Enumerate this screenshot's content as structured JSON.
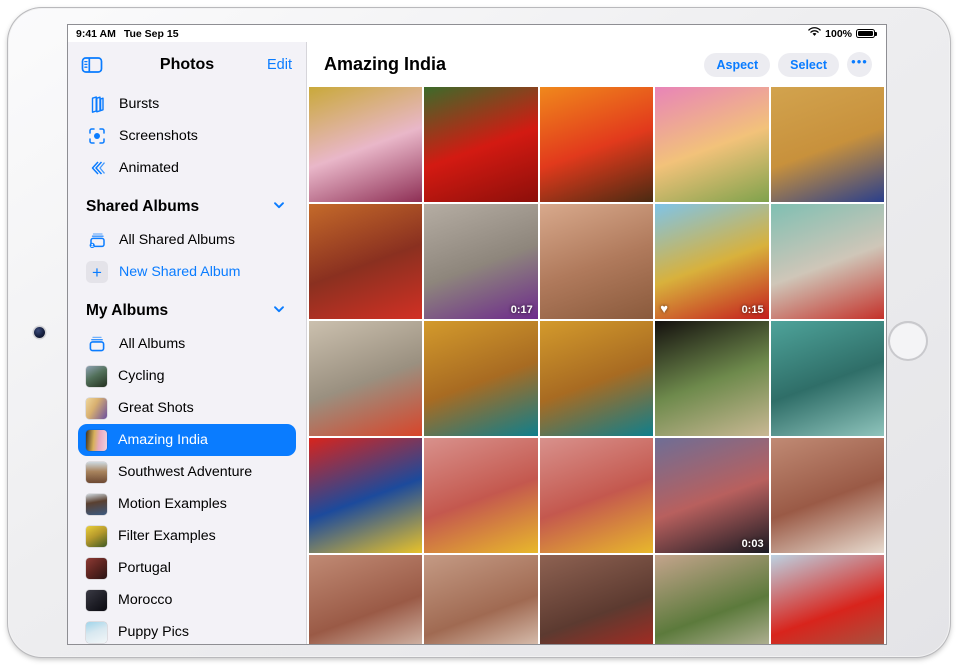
{
  "status_bar": {
    "time": "9:41 AM",
    "date": "Tue Sep 15",
    "wifi_icon": "wifi-icon",
    "battery_percent": "100%",
    "battery_icon": "battery-icon"
  },
  "sidebar": {
    "toggle_icon": "sidebar-toggle-icon",
    "title": "Photos",
    "edit_label": "Edit",
    "items": [
      {
        "label": "Bursts",
        "icon": "bursts-icon",
        "kind": "glyph",
        "selected": false
      },
      {
        "label": "Screenshots",
        "icon": "screenshots-icon",
        "kind": "glyph",
        "selected": false
      },
      {
        "label": "Animated",
        "icon": "animated-icon",
        "kind": "glyph",
        "selected": false
      }
    ],
    "shared_albums": {
      "heading": "Shared Albums",
      "chevron_icon": "chevron-down-icon",
      "items": [
        {
          "label": "All Shared Albums",
          "icon": "shared-album-icon",
          "kind": "glyph",
          "selected": false
        },
        {
          "label": "New Shared Album",
          "icon": "plus-icon",
          "kind": "plus",
          "selected": false,
          "accent": true
        }
      ]
    },
    "my_albums": {
      "heading": "My Albums",
      "chevron_icon": "chevron-down-icon",
      "items": [
        {
          "label": "All Albums",
          "icon": "albums-stack-icon",
          "kind": "glyph",
          "selected": false
        },
        {
          "label": "Cycling",
          "icon": "album-thumbnail",
          "kind": "thumb",
          "selected": false,
          "c1": "#7b8a9a",
          "c2": "#2d3a2a"
        },
        {
          "label": "Great Shots",
          "icon": "album-thumbnail",
          "kind": "thumb",
          "selected": false,
          "c1": "#e8c98a",
          "c2": "#6b4fa0"
        },
        {
          "label": "Amazing India",
          "icon": "album-thumbnail",
          "kind": "thumb",
          "selected": true,
          "c1": "#d8b15a",
          "c2": "#e7a9c0"
        },
        {
          "label": "Southwest Adventure",
          "icon": "album-thumbnail",
          "kind": "thumb",
          "selected": false,
          "c1": "#9c7a5c",
          "c2": "#d8cfc2"
        },
        {
          "label": "Motion Examples",
          "icon": "album-thumbnail",
          "kind": "thumb",
          "selected": false,
          "c1": "#b9c3cc",
          "c2": "#3c5a80"
        },
        {
          "label": "Filter Examples",
          "icon": "album-thumbnail",
          "kind": "thumb",
          "selected": false,
          "c1": "#e3c32e",
          "c2": "#3f5a24"
        },
        {
          "label": "Portugal",
          "icon": "album-thumbnail",
          "kind": "thumb",
          "selected": false,
          "c1": "#7a3030",
          "c2": "#2a1414"
        },
        {
          "label": "Morocco",
          "icon": "album-thumbnail",
          "kind": "thumb",
          "selected": false,
          "c1": "#2a2a30",
          "c2": "#0d0d12"
        },
        {
          "label": "Puppy Pics",
          "icon": "album-thumbnail",
          "kind": "thumb",
          "selected": false,
          "c1": "#bfe3f2",
          "c2": "#e8eef2"
        }
      ]
    }
  },
  "detail": {
    "title": "Amazing India",
    "aspect_label": "Aspect",
    "select_label": "Select",
    "more_label": "•••",
    "more_icon": "ellipsis-icon"
  },
  "grid": {
    "columns": 5,
    "photos": [
      {
        "id": "p1",
        "desc": "yellow door and pink wall",
        "c1": "#c9a93a",
        "c2": "#e9b7c9",
        "c3": "#8e2f55",
        "badge": null,
        "favorite": false
      },
      {
        "id": "p2",
        "desc": "red poppy flower",
        "c1": "#3c6b2a",
        "c2": "#d31a12",
        "c3": "#8c0f0a",
        "badge": null,
        "favorite": false
      },
      {
        "id": "p3",
        "desc": "oranges in red crate",
        "c1": "#f0881c",
        "c2": "#e23a1c",
        "c3": "#4a2a12",
        "badge": null,
        "favorite": false
      },
      {
        "id": "p4",
        "desc": "pink snapdragon blossoms",
        "c1": "#e884b8",
        "c2": "#f2c27a",
        "c3": "#7fa24c",
        "badge": null,
        "favorite": false
      },
      {
        "id": "p5",
        "desc": "man in blue by ochre wall",
        "c1": "#d2a34e",
        "c2": "#c8913c",
        "c3": "#2a3f8c",
        "badge": null,
        "favorite": false
      },
      {
        "id": "p6",
        "desc": "woman with curly hair in red",
        "c1": "#c46a2a",
        "c2": "#8a3020",
        "c3": "#d23024",
        "badge": null,
        "favorite": false
      },
      {
        "id": "p7",
        "desc": "aerial purple powder on street",
        "c1": "#b5ada3",
        "c2": "#8e867c",
        "c3": "#6d2a8c",
        "badge": "0:17",
        "favorite": false
      },
      {
        "id": "p8",
        "desc": "two faces close up",
        "c1": "#d8a98c",
        "c2": "#b07a5c",
        "c3": "#8a5a3c",
        "badge": null,
        "favorite": false
      },
      {
        "id": "p9",
        "desc": "red and gold kite tails in sky",
        "c1": "#7fc4e8",
        "c2": "#d8b13c",
        "c3": "#c41e1e",
        "badge": "0:15",
        "favorite": true
      },
      {
        "id": "p10",
        "desc": "woman in striped dress at wall",
        "c1": "#7fbfb2",
        "c2": "#cfc6b8",
        "c3": "#c4312a",
        "badge": null,
        "favorite": false
      },
      {
        "id": "p11",
        "desc": "man in orange by old door",
        "c1": "#cbc0ae",
        "c2": "#9a9080",
        "c3": "#d8452a",
        "badge": null,
        "favorite": false
      },
      {
        "id": "p12",
        "desc": "portrait yellow headwrap",
        "c1": "#d39a2c",
        "c2": "#a86b22",
        "c3": "#0f7f8c",
        "badge": null,
        "favorite": false
      },
      {
        "id": "p13",
        "desc": "portrait hands over face",
        "c1": "#d39a2c",
        "c2": "#a86b22",
        "c3": "#0f7f8c",
        "badge": null,
        "favorite": false
      },
      {
        "id": "p14",
        "desc": "archway view to garden",
        "c1": "#14100e",
        "c2": "#6e8a4c",
        "c3": "#c9b894",
        "badge": null,
        "favorite": false
      },
      {
        "id": "p15",
        "desc": "weathered teal door",
        "c1": "#4ea39a",
        "c2": "#2f6e68",
        "c3": "#8fc4bc",
        "badge": null,
        "favorite": false
      },
      {
        "id": "p16",
        "desc": "pile of red and blue fabric",
        "c1": "#d8241c",
        "c2": "#1c4a9c",
        "c3": "#e8c22a",
        "badge": null,
        "favorite": false
      },
      {
        "id": "p17",
        "desc": "worker drying red cloth",
        "c1": "#d8918c",
        "c2": "#c4584e",
        "c3": "#e8b82c",
        "badge": null,
        "favorite": false
      },
      {
        "id": "p18",
        "desc": "worker stretching red cloth",
        "c1": "#d8918c",
        "c2": "#c4584e",
        "c3": "#e8b82c",
        "badge": null,
        "favorite": false
      },
      {
        "id": "p19",
        "desc": "silhouette in pink arch at dusk",
        "c1": "#6e6e96",
        "c2": "#b8605e",
        "c3": "#1a1a22",
        "badge": "0:03",
        "favorite": false
      },
      {
        "id": "p20",
        "desc": "red sandstone tomb facade",
        "c1": "#c08a74",
        "c2": "#9a5a46",
        "c3": "#e8dcd0",
        "badge": null,
        "favorite": false
      },
      {
        "id": "p21",
        "desc": "humayun tomb wide facade",
        "c1": "#c08a74",
        "c2": "#9a5a46",
        "c3": "#e8dcd0",
        "badge": null,
        "favorite": false
      },
      {
        "id": "p22",
        "desc": "tomb archway with woman",
        "c1": "#c49a84",
        "c2": "#a06a52",
        "c3": "#f0e4d8",
        "badge": null,
        "favorite": false
      },
      {
        "id": "p23",
        "desc": "woman in red on stone stairs",
        "c1": "#8e6252",
        "c2": "#5c3a30",
        "c3": "#c4241c",
        "badge": null,
        "favorite": false
      },
      {
        "id": "p24",
        "desc": "garden path with trees",
        "c1": "#c4a48c",
        "c2": "#5c7a3c",
        "c3": "#d8cabc",
        "badge": null,
        "favorite": false
      },
      {
        "id": "p25",
        "desc": "woman twirling red sari",
        "c1": "#bcd2e2",
        "c2": "#d8241c",
        "c3": "#8e6a52",
        "badge": null,
        "favorite": false
      }
    ]
  },
  "colors": {
    "accent": "#0a7cff",
    "sidebar_bg": "#f3f2f7",
    "pill_bg": "#ececf1",
    "selected_bg": "#0a7cff"
  }
}
